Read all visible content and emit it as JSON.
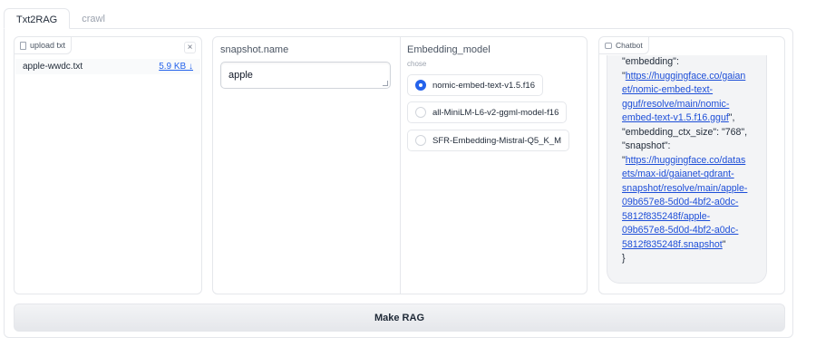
{
  "tabs": [
    {
      "label": "Txt2RAG",
      "active": true
    },
    {
      "label": "crawl",
      "active": false
    }
  ],
  "upload": {
    "label": "upload txt",
    "icon": "file-icon",
    "close_label": "×",
    "file_name": "apple-wwdc.txt",
    "file_size": "5.9 KB ↓"
  },
  "snapshot": {
    "label": "snapshot.name",
    "value": "apple"
  },
  "embedding": {
    "label": "Embedding_model",
    "info": "chose",
    "options": [
      {
        "label": "nomic-embed-text-v1.5.f16",
        "selected": true
      },
      {
        "label": "all-MiniLM-L6-v2-ggml-model-f16",
        "selected": false
      },
      {
        "label": "SFR-Embedding-Mistral-Q5_K_M",
        "selected": false
      }
    ]
  },
  "chatbot": {
    "label": "Chatbot",
    "icon": "chat-icon",
    "lines": [
      {
        "text": "\"embedding\":",
        "link": false
      },
      {
        "pre": "\"",
        "text": "https://huggingface.co/gaian",
        "link": true
      },
      {
        "text": "et/nomic-embed-text-",
        "link": true
      },
      {
        "text": "gguf/resolve/main/nomic-",
        "link": true
      },
      {
        "text": "embed-text-v1.5.f16.gguf",
        "post": "\",",
        "link": true
      },
      {
        "text": "\"embedding_ctx_size\": \"768\",",
        "link": false
      },
      {
        "text": "\"snapshot\":",
        "link": false
      },
      {
        "pre": "\"",
        "text": "https://huggingface.co/datas",
        "link": true
      },
      {
        "text": "ets/max-id/gaianet-qdrant-",
        "link": true
      },
      {
        "text": "snapshot/resolve/main/apple-",
        "link": true
      },
      {
        "text": "09b657e8-5d0d-4bf2-a0dc-",
        "link": true
      },
      {
        "text": "5812f835248f/apple-",
        "link": true
      },
      {
        "text": "09b657e8-5d0d-4bf2-a0dc-",
        "link": true
      },
      {
        "text": "5812f835248f.snapshot",
        "post": "\"",
        "link": true
      },
      {
        "text": "}",
        "link": false
      }
    ]
  },
  "make_button": {
    "label": "Make RAG"
  },
  "colors": {
    "accent": "#2563eb",
    "border": "#e5e7eb",
    "bubble": "#f3f4f6"
  }
}
